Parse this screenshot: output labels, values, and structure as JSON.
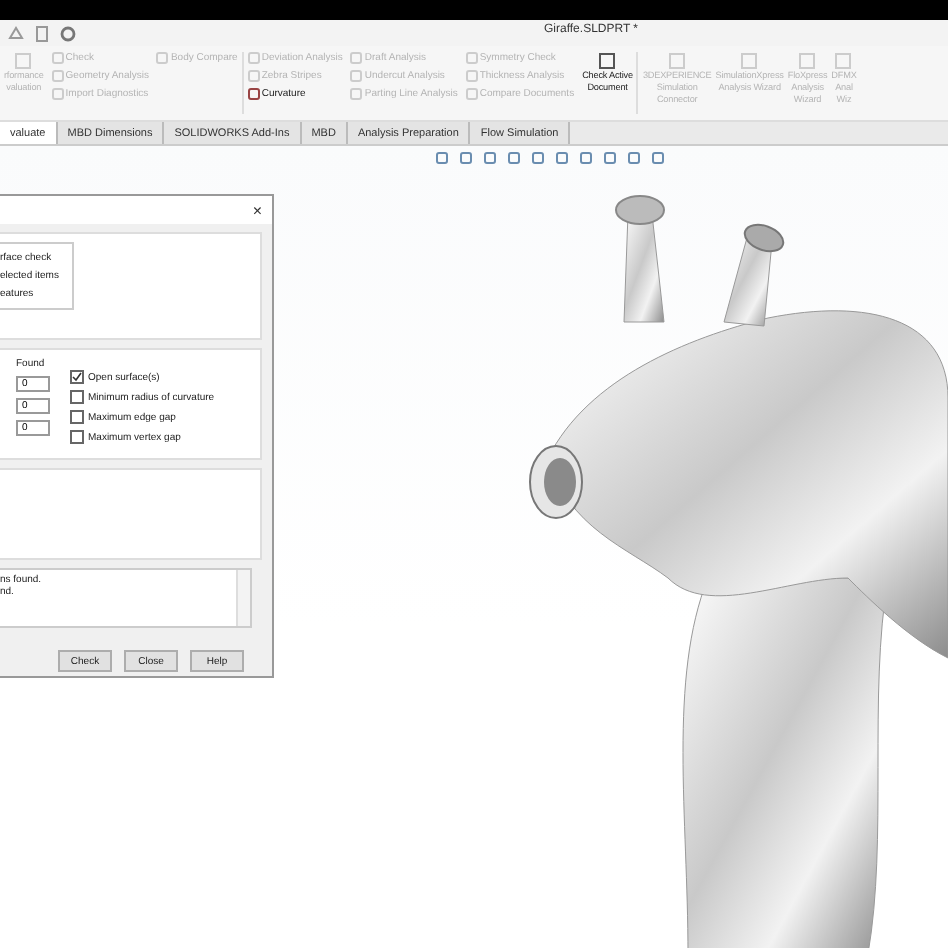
{
  "window": {
    "title": "Giraffe.SLDPRT *"
  },
  "ribbon": {
    "groups": [
      {
        "items": [
          {
            "label": "rformance\nvaluation",
            "disabled": true,
            "kind": "large"
          }
        ]
      },
      {
        "items": [
          {
            "label": "Check",
            "disabled": true,
            "kind": "small"
          },
          {
            "label": "Geometry Analysis",
            "disabled": true,
            "kind": "small"
          },
          {
            "label": "Import Diagnostics",
            "disabled": true,
            "kind": "small"
          }
        ]
      },
      {
        "items": [
          {
            "label": "Body Compare",
            "disabled": true,
            "kind": "small"
          }
        ]
      },
      {
        "items": [
          {
            "label": "Deviation Analysis",
            "disabled": true,
            "kind": "small"
          },
          {
            "label": "Zebra Stripes",
            "disabled": true,
            "kind": "small"
          },
          {
            "label": "Curvature",
            "disabled": false,
            "kind": "small"
          }
        ]
      },
      {
        "items": [
          {
            "label": "Draft Analysis",
            "disabled": true,
            "kind": "small"
          },
          {
            "label": "Undercut Analysis",
            "disabled": true,
            "kind": "small"
          },
          {
            "label": "Parting Line Analysis",
            "disabled": true,
            "kind": "small"
          }
        ]
      },
      {
        "items": [
          {
            "label": "Symmetry Check",
            "disabled": true,
            "kind": "small"
          },
          {
            "label": "Thickness Analysis",
            "disabled": true,
            "kind": "small"
          },
          {
            "label": "Compare Documents",
            "disabled": true,
            "kind": "small"
          }
        ]
      },
      {
        "items": [
          {
            "label": "Check Active\nDocument",
            "disabled": false,
            "kind": "large"
          }
        ]
      },
      {
        "items": [
          {
            "label": "3DEXPERIENCE\nSimulation\nConnector",
            "disabled": true,
            "kind": "large"
          },
          {
            "label": "SimulationXpress\nAnalysis Wizard",
            "disabled": true,
            "kind": "large"
          },
          {
            "label": "FloXpress\nAnalysis\nWizard",
            "disabled": true,
            "kind": "large"
          },
          {
            "label": "DFMX\nAnal\nWiz",
            "disabled": true,
            "kind": "large"
          }
        ]
      }
    ]
  },
  "tabs": [
    {
      "label": "valuate",
      "selected": true
    },
    {
      "label": "MBD Dimensions",
      "selected": false
    },
    {
      "label": "SOLIDWORKS Add-Ins",
      "selected": false
    },
    {
      "label": "MBD",
      "selected": false
    },
    {
      "label": "Analysis Preparation",
      "selected": false
    },
    {
      "label": "Flow Simulation",
      "selected": false
    }
  ],
  "dialog": {
    "close": "×",
    "options": [
      "rface check",
      "elected items",
      "eatures"
    ],
    "found_heading": "Found",
    "found": [
      "0",
      "0",
      "0"
    ],
    "checks": [
      {
        "label": "Open surface(s)",
        "checked": true
      },
      {
        "label": "Minimum radius of curvature",
        "checked": false
      },
      {
        "label": "Maximum edge gap",
        "checked": false
      },
      {
        "label": "Maximum vertex gap",
        "checked": false
      }
    ],
    "message": [
      "ns found.",
      "nd."
    ],
    "buttons": [
      "Check",
      "Close",
      "Help"
    ]
  }
}
